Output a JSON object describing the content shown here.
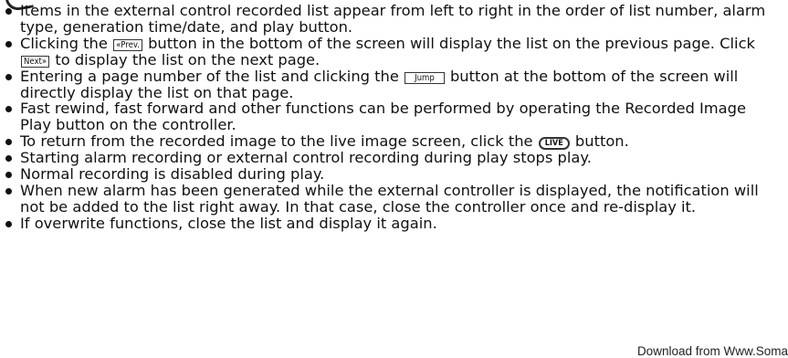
{
  "items": {
    "i1": "Items in the external control recorded list appear from left to right in the order of list number, alarm type, generation time/date, and play button.",
    "i2_a": "Clicking the",
    "i2_prev": "«Prev.",
    "i2_b": "button in the bottom of the screen will display the list on the previous page. Click",
    "i2_next": "Next»",
    "i2_c": "to display the list on the next page.",
    "i3_a": "Entering a page number of the list and clicking the",
    "i3_jump": "Jump",
    "i3_b": "button at the bottom of the screen will directly display the list on that page.",
    "i4": "Fast rewind, fast forward and other functions can be performed by operating the Recorded Image Play button on the controller.",
    "i5_a": "To return from the recorded image to the live image screen, click the",
    "i5_live": "LIVE",
    "i5_b": "button.",
    "i6": "Starting alarm recording or external control recording during play stops play.",
    "i7": "Normal recording is disabled during play.",
    "i8": "When new alarm has been generated while the external controller is displayed, the notification will not be added to the list right away. In that case, close the controller once and re-display it.",
    "i9": "If overwrite functions, close the list and display it again."
  },
  "footer": {
    "download_note": "Download from Www.Soma"
  }
}
